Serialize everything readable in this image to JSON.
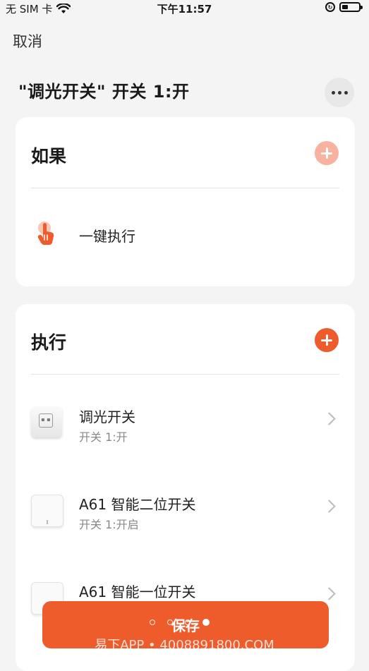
{
  "status_bar": {
    "carrier": "无 SIM 卡",
    "time": "下午11:57"
  },
  "header": {
    "cancel_label": "取消",
    "title": "\"调光开关\" 开关 1:开"
  },
  "if_section": {
    "title": "如果",
    "add_color": "#f7b3a0",
    "items": [
      {
        "label": "一键执行",
        "icon": "hand-tap-icon"
      }
    ]
  },
  "do_section": {
    "title": "执行",
    "add_color": "#ef5c2c",
    "items": [
      {
        "name": "调光开关",
        "detail": "开关 1:开",
        "icon": "dimmer-switch-icon"
      },
      {
        "name": "A61 智能二位开关",
        "detail": "开关 1:开启",
        "icon": "double-switch-icon"
      },
      {
        "name": "A61 智能一位开关",
        "detail": "",
        "icon": "single-switch-icon"
      }
    ]
  },
  "footer": {
    "save_label": "保存",
    "accent": "#ef5c2c",
    "page_indicator": {
      "total": 3,
      "current": 3
    },
    "watermark": "易下APP • 4008891800.COM"
  }
}
